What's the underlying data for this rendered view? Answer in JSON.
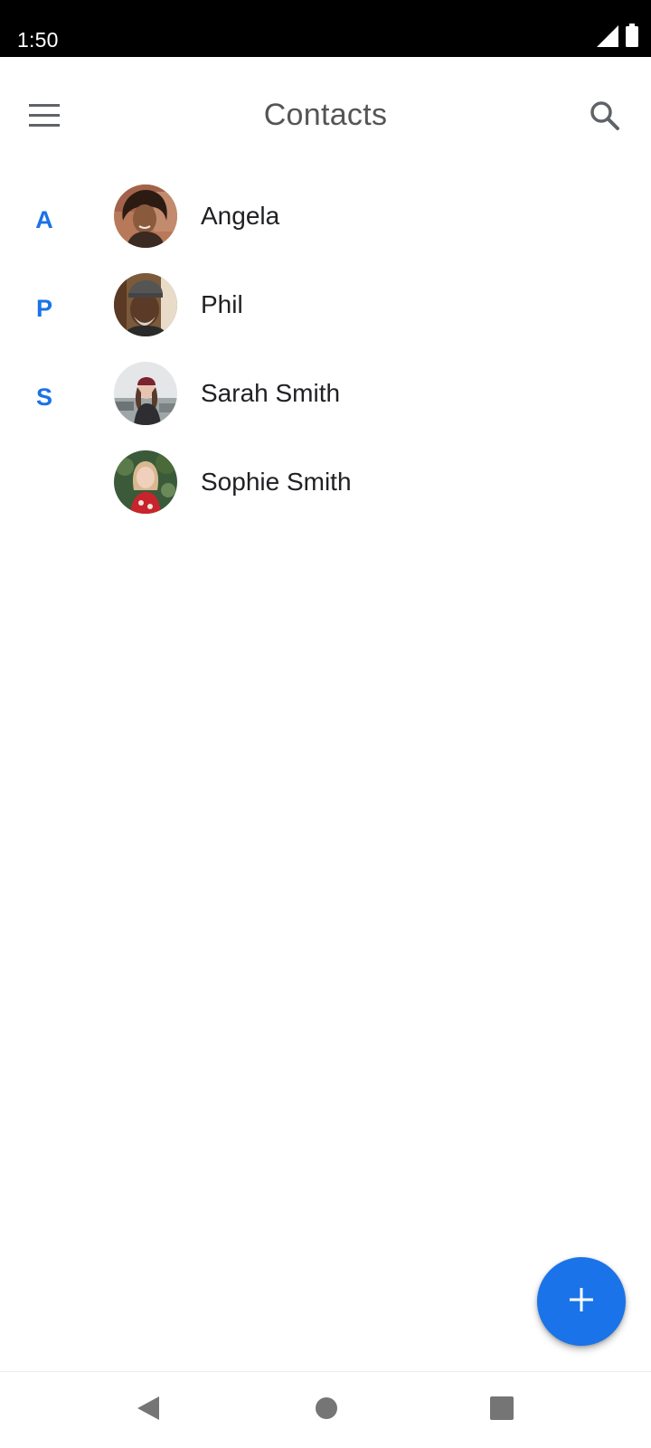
{
  "status_bar": {
    "time": "1:50",
    "icons": [
      "cell-signal-icon",
      "battery-icon"
    ]
  },
  "app_bar": {
    "title": "Contacts",
    "menu_icon": "hamburger-menu-icon",
    "search_icon": "search-icon"
  },
  "contacts": [
    {
      "section": "A",
      "name": "Angela",
      "avatar": "photo-angela"
    },
    {
      "section": "P",
      "name": "Phil",
      "avatar": "photo-phil"
    },
    {
      "section": "S",
      "name": "Sarah Smith",
      "avatar": "photo-sarah-smith"
    },
    {
      "section": "",
      "name": "Sophie Smith",
      "avatar": "photo-sophie-smith"
    }
  ],
  "fab": {
    "icon": "plus-icon"
  },
  "nav_bar": {
    "icons": [
      "back-triangle-icon",
      "home-circle-icon",
      "recents-square-icon"
    ]
  },
  "colors": {
    "accent": "#1a73e8",
    "title_text": "#555555",
    "name_text": "#202124",
    "status_bar_bg": "#000000"
  }
}
